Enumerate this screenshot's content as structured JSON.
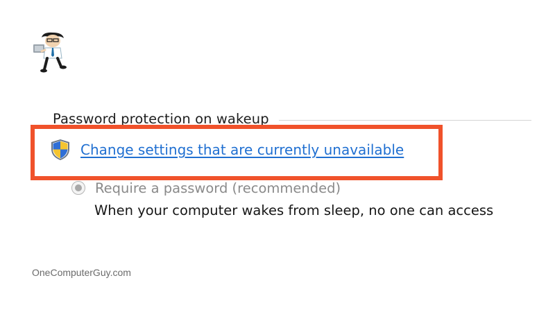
{
  "logo": {
    "icon": "computer-guy-logo-icon"
  },
  "section": {
    "title": "Password protection on wakeup"
  },
  "change_link": {
    "icon": "uac-shield-icon",
    "label": "Change settings that are currently unavailable"
  },
  "option": {
    "label": "Require a password (recommended)",
    "selected": true,
    "enabled": false,
    "description": "When your computer wakes from sleep, no one can access"
  },
  "watermark": {
    "text": "OneComputerGuy.com"
  },
  "colors": {
    "highlight_border": "#f0522b",
    "link": "#1f6fd1",
    "disabled_text": "#8a8a8a"
  }
}
